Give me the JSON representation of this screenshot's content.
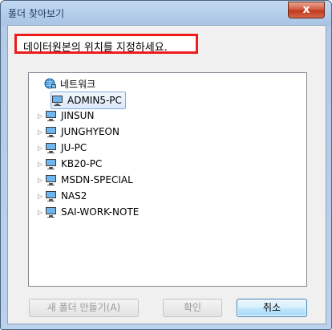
{
  "window": {
    "title": "폴더 찾아보기",
    "close_label": "x"
  },
  "instruction": "데이터원본의 위치를 지정하세요.",
  "tree": {
    "root": {
      "label": "네트워크",
      "icon": "network-icon"
    },
    "items": [
      {
        "label": "ADMIN5-PC",
        "icon": "computer-icon",
        "selected": true,
        "expandable": false
      },
      {
        "label": "JINSUN",
        "icon": "computer-icon",
        "selected": false,
        "expandable": true
      },
      {
        "label": "JUNGHYEON",
        "icon": "computer-icon",
        "selected": false,
        "expandable": true
      },
      {
        "label": "JU-PC",
        "icon": "computer-icon",
        "selected": false,
        "expandable": true
      },
      {
        "label": "KB20-PC",
        "icon": "computer-icon",
        "selected": false,
        "expandable": true
      },
      {
        "label": "MSDN-SPECIAL",
        "icon": "computer-icon",
        "selected": false,
        "expandable": true
      },
      {
        "label": "NAS2",
        "icon": "computer-icon",
        "selected": false,
        "expandable": true
      },
      {
        "label": "SAI-WORK-NOTE",
        "icon": "computer-icon",
        "selected": false,
        "expandable": true
      }
    ]
  },
  "buttons": {
    "new_folder": "새 폴더 만들기(A)",
    "ok": "확인",
    "cancel": "취소"
  },
  "colors": {
    "highlight_border": "#ee1c1c",
    "selection_bg": "#dbe9fa",
    "close_button": "#c2381c"
  }
}
